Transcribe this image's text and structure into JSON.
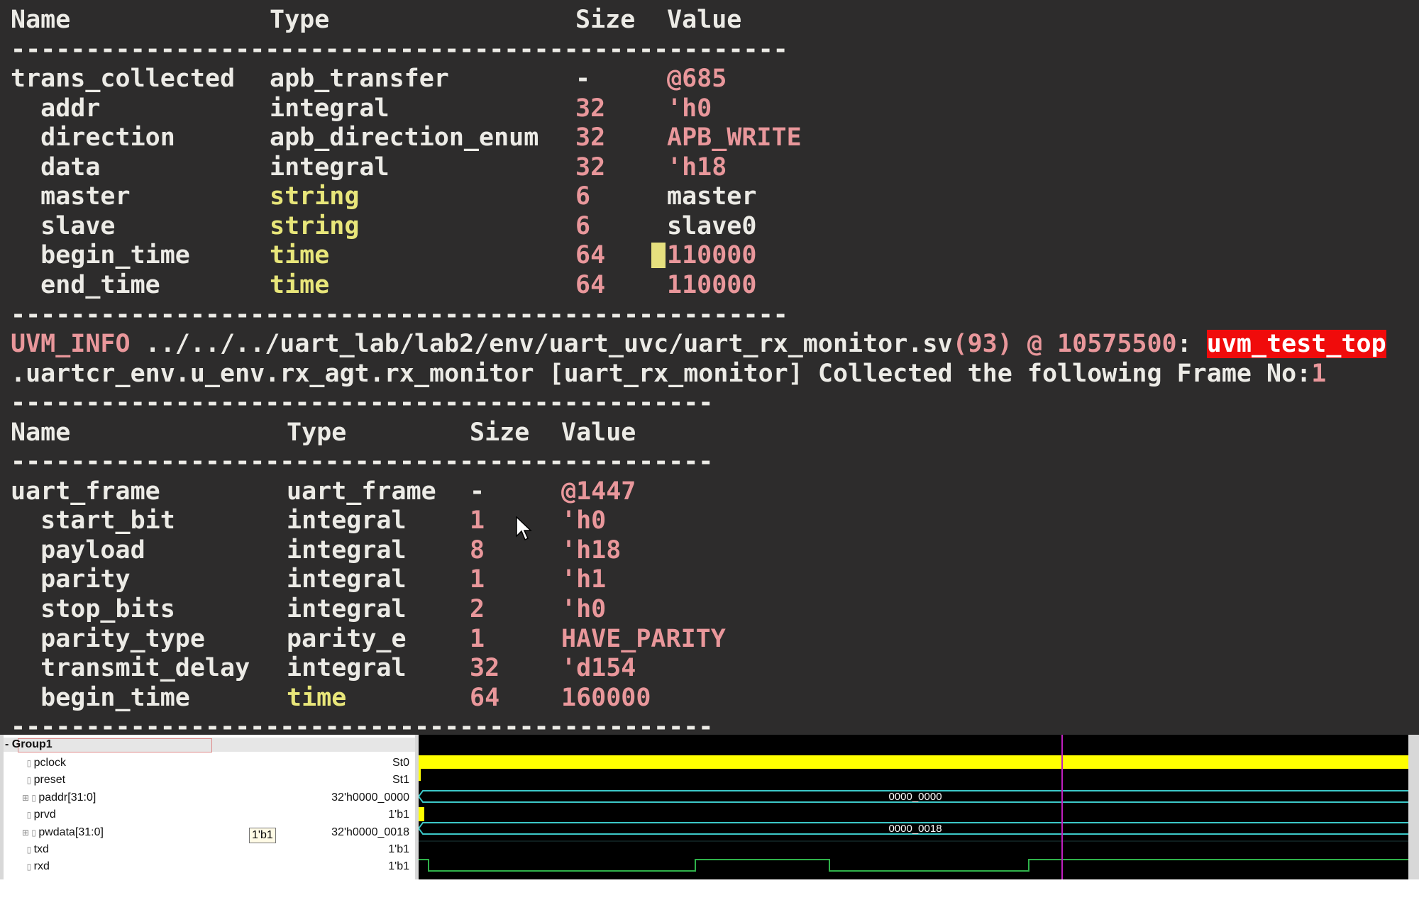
{
  "table1": {
    "header": {
      "name": "Name",
      "type": "Type",
      "size": "Size",
      "value": "Value"
    },
    "separator": "----------------------------------------------------",
    "rows": [
      {
        "name": "trans_collected",
        "type": "apb_transfer",
        "size": "-",
        "value": "@685"
      },
      {
        "name": "  addr",
        "type": "integral",
        "size": "32",
        "value": "'h0"
      },
      {
        "name": "  direction",
        "type": "apb_direction_enum",
        "size": "32",
        "value": "APB_WRITE"
      },
      {
        "name": "  data",
        "type": "integral",
        "size": "32",
        "value": "'h18"
      },
      {
        "name": "  master",
        "type": "string",
        "size": "6",
        "value": "master"
      },
      {
        "name": "  slave",
        "type": "string",
        "size": "6",
        "value": "slave0"
      },
      {
        "name": "  begin_time",
        "type": "time",
        "size": "64",
        "value": "110000"
      },
      {
        "name": "  end_time",
        "type": "time",
        "size": "64",
        "value": "110000"
      }
    ]
  },
  "log": {
    "tag": "UVM_INFO",
    "path": " ../../../uart_lab/lab2/env/uart_uvc/uart_rx_monitor.sv",
    "line": "(93)",
    "at": " @ ",
    "time": "10575500",
    "colon": ": ",
    "highlight": "uvm_test_top",
    "line2": ".uartcr_env.u_env.rx_agt.rx_monitor [uart_rx_monitor] Collected the following Frame No:",
    "frame_no": "1"
  },
  "table2": {
    "header": {
      "name": "Name",
      "type": "Type",
      "size": "Size",
      "value": "Value"
    },
    "separator": "-----------------------------------------------",
    "rows": [
      {
        "name": "uart_frame",
        "type": "uart_frame",
        "size": "-",
        "value": "@1447"
      },
      {
        "name": "  start_bit",
        "type": "integral",
        "size": "1",
        "value": "'h0"
      },
      {
        "name": "  payload",
        "type": "integral",
        "size": "8",
        "value": "'h18"
      },
      {
        "name": "  parity",
        "type": "integral",
        "size": "1",
        "value": "'h1"
      },
      {
        "name": "  stop_bits",
        "type": "integral",
        "size": "2",
        "value": "'h0"
      },
      {
        "name": "  parity_type",
        "type": "parity_e",
        "size": "1",
        "value": "HAVE_PARITY"
      },
      {
        "name": "  transmit_delay",
        "type": "integral",
        "size": "32",
        "value": "'d154"
      },
      {
        "name": "  begin_time",
        "type": "time",
        "size": "64",
        "value": "160000"
      }
    ]
  },
  "waveform": {
    "group": "Group1",
    "signals": [
      {
        "name": "pclock",
        "value": "St0"
      },
      {
        "name": "preset",
        "value": "St1"
      },
      {
        "name": "paddr[31:0]",
        "value": "32'h0000_0000",
        "bus_label": "0000_0000"
      },
      {
        "name": "prvd",
        "value": "1'b1"
      },
      {
        "name": "pwdata[31:0]",
        "value": "32'h0000_0018",
        "bus_label": "0000_0018"
      },
      {
        "name": "txd",
        "value": "1'b1"
      },
      {
        "name": "rxd",
        "value": "1'b1"
      }
    ],
    "tooltip": "1'b1",
    "colors": {
      "clock": "#ffff00",
      "bus": "#3cc8c8",
      "signal": "#2fb24a",
      "cursor": "#c020c0"
    }
  }
}
